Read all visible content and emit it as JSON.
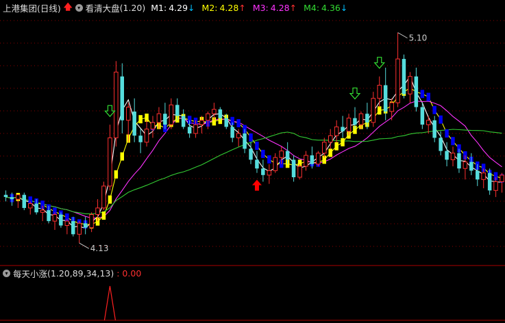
{
  "header": {
    "stock_name": "上港集团",
    "period": "(日线)",
    "indicator_name": "看清大盘",
    "indicator_params": "(1.20)",
    "ma": [
      {
        "label": "M1:",
        "value": "4.29",
        "arrow": "↓",
        "color": "#ffffff",
        "arrow_color": "#00bfff"
      },
      {
        "label": "M2:",
        "value": "4.28",
        "arrow": "↑",
        "color": "#ffff00",
        "arrow_color": "#ff3030"
      },
      {
        "label": "M3:",
        "value": "4.28",
        "arrow": "↑",
        "color": "#ff33ff",
        "arrow_color": "#ff3030"
      },
      {
        "label": "M4:",
        "value": "4.36",
        "arrow": "↓",
        "color": "#33dd33",
        "arrow_color": "#00bfff"
      }
    ]
  },
  "price_annotations": {
    "high_label": "5.10",
    "low_label": "4.13"
  },
  "sub_panel": {
    "indicator_name": "每天小涨",
    "indicator_params": "(1.20,89,34,13)",
    "value_text": ": 0.00"
  },
  "colors": {
    "up": "#ff3030",
    "down": "#55dddd",
    "grid": "#8b0000",
    "band_yellow": "#ffff00",
    "band_blue": "#0000ee",
    "ma_white": "#ffffff",
    "ma_yellow": "#ffff00",
    "ma_magenta": "#ff33ff",
    "ma_green": "#33cc33",
    "buy_arrow": "#ff0000",
    "sell_arrow": "#33dd33"
  },
  "chart_data": {
    "type": "candlestick",
    "y_range": [
      4.05,
      5.18
    ],
    "candles": [
      [
        4.36,
        4.38,
        4.33,
        4.35
      ],
      [
        4.35,
        4.37,
        4.31,
        4.34
      ],
      [
        4.34,
        4.36,
        4.3,
        4.36
      ],
      [
        4.36,
        4.37,
        4.29,
        4.3
      ],
      [
        4.3,
        4.33,
        4.27,
        4.32
      ],
      [
        4.32,
        4.34,
        4.27,
        4.28
      ],
      [
        4.28,
        4.31,
        4.24,
        4.29
      ],
      [
        4.29,
        4.31,
        4.23,
        4.24
      ],
      [
        4.24,
        4.28,
        4.2,
        4.27
      ],
      [
        4.27,
        4.28,
        4.21,
        4.22
      ],
      [
        4.22,
        4.25,
        4.18,
        4.24
      ],
      [
        4.24,
        4.26,
        4.17,
        4.18
      ],
      [
        4.18,
        4.24,
        4.14,
        4.23
      ],
      [
        4.23,
        4.26,
        4.18,
        4.21
      ],
      [
        4.21,
        4.28,
        4.19,
        4.27
      ],
      [
        4.27,
        4.34,
        4.24,
        4.3
      ],
      [
        4.3,
        4.42,
        4.29,
        4.4
      ],
      [
        4.4,
        4.68,
        4.38,
        4.62
      ],
      [
        4.62,
        4.97,
        4.58,
        4.92
      ],
      [
        4.9,
        4.96,
        4.64,
        4.7
      ],
      [
        4.7,
        4.78,
        4.6,
        4.76
      ],
      [
        4.74,
        4.8,
        4.6,
        4.63
      ],
      [
        4.63,
        4.66,
        4.55,
        4.6
      ],
      [
        4.6,
        4.7,
        4.58,
        4.66
      ],
      [
        4.66,
        4.72,
        4.62,
        4.69
      ],
      [
        4.69,
        4.76,
        4.66,
        4.73
      ],
      [
        4.73,
        4.78,
        4.66,
        4.68
      ],
      [
        4.68,
        4.8,
        4.66,
        4.77
      ],
      [
        4.77,
        4.8,
        4.7,
        4.72
      ],
      [
        4.72,
        4.75,
        4.66,
        4.67
      ],
      [
        4.67,
        4.7,
        4.62,
        4.64
      ],
      [
        4.64,
        4.7,
        4.62,
        4.68
      ],
      [
        4.68,
        4.72,
        4.64,
        4.7
      ],
      [
        4.7,
        4.74,
        4.66,
        4.73
      ],
      [
        4.73,
        4.78,
        4.7,
        4.75
      ],
      [
        4.75,
        4.76,
        4.7,
        4.71
      ],
      [
        4.71,
        4.73,
        4.66,
        4.67
      ],
      [
        4.67,
        4.69,
        4.6,
        4.62
      ],
      [
        4.62,
        4.66,
        4.58,
        4.64
      ],
      [
        4.64,
        4.66,
        4.55,
        4.57
      ],
      [
        4.57,
        4.6,
        4.5,
        4.52
      ],
      [
        4.52,
        4.56,
        4.46,
        4.48
      ],
      [
        4.48,
        4.52,
        4.42,
        4.45
      ],
      [
        4.45,
        4.5,
        4.41,
        4.47
      ],
      [
        4.47,
        4.55,
        4.46,
        4.53
      ],
      [
        4.53,
        4.58,
        4.5,
        4.56
      ],
      [
        4.56,
        4.6,
        4.5,
        4.52
      ],
      [
        4.52,
        4.54,
        4.42,
        4.44
      ],
      [
        4.44,
        4.5,
        4.43,
        4.49
      ],
      [
        4.49,
        4.56,
        4.47,
        4.54
      ],
      [
        4.54,
        4.58,
        4.48,
        4.5
      ],
      [
        4.5,
        4.56,
        4.49,
        4.55
      ],
      [
        4.55,
        4.62,
        4.53,
        4.6
      ],
      [
        4.6,
        4.66,
        4.57,
        4.63
      ],
      [
        4.63,
        4.7,
        4.6,
        4.67
      ],
      [
        4.67,
        4.72,
        4.62,
        4.65
      ],
      [
        4.65,
        4.73,
        4.63,
        4.71
      ],
      [
        4.71,
        4.76,
        4.66,
        4.68
      ],
      [
        4.68,
        4.74,
        4.66,
        4.73
      ],
      [
        4.73,
        4.78,
        4.66,
        4.69
      ],
      [
        4.69,
        4.83,
        4.67,
        4.8
      ],
      [
        4.8,
        4.9,
        4.76,
        4.86
      ],
      [
        4.86,
        4.94,
        4.7,
        4.74
      ],
      [
        4.74,
        4.8,
        4.7,
        4.78
      ],
      [
        4.78,
        5.1,
        4.76,
        4.98
      ],
      [
        4.98,
        5.0,
        4.8,
        4.82
      ],
      [
        4.82,
        4.92,
        4.78,
        4.9
      ],
      [
        4.9,
        4.94,
        4.74,
        4.76
      ],
      [
        4.76,
        4.78,
        4.66,
        4.68
      ],
      [
        4.68,
        4.72,
        4.64,
        4.7
      ],
      [
        4.7,
        4.72,
        4.6,
        4.62
      ],
      [
        4.62,
        4.65,
        4.54,
        4.56
      ],
      [
        4.56,
        4.6,
        4.49,
        4.52
      ],
      [
        4.52,
        4.58,
        4.49,
        4.55
      ],
      [
        4.55,
        4.57,
        4.46,
        4.48
      ],
      [
        4.48,
        4.54,
        4.43,
        4.51
      ],
      [
        4.51,
        4.55,
        4.45,
        4.47
      ],
      [
        4.47,
        4.5,
        4.4,
        4.43
      ],
      [
        4.43,
        4.48,
        4.39,
        4.46
      ],
      [
        4.46,
        4.48,
        4.36,
        4.38
      ],
      [
        4.38,
        4.44,
        4.35,
        4.42
      ],
      [
        4.42,
        4.46,
        4.37,
        4.45
      ]
    ]
  }
}
